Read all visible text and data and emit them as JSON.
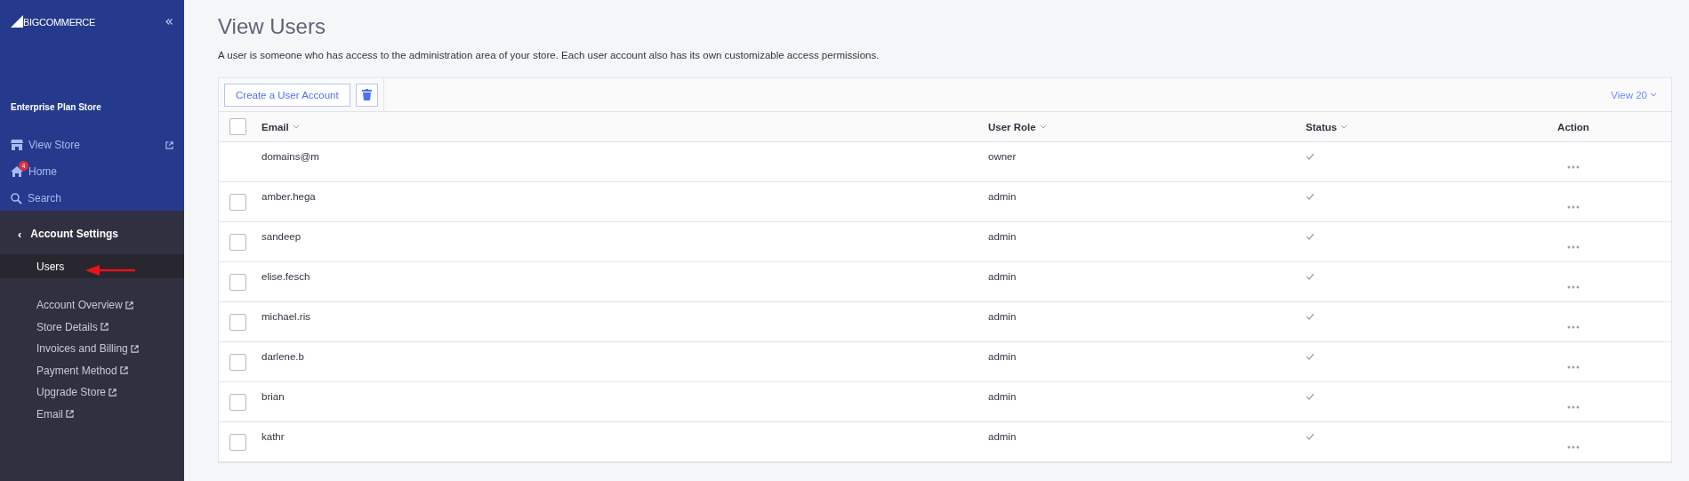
{
  "sidebar": {
    "brand": "BIGCOMMERCE",
    "collapse_icon": "«",
    "plan": "Enterprise Plan Store",
    "nav": [
      {
        "kind": "store",
        "label": "View Store",
        "external": true
      },
      {
        "kind": "home",
        "label": "Home",
        "badge": "4",
        "external": false
      },
      {
        "kind": "search",
        "label": "Search",
        "external": false
      }
    ],
    "section": {
      "back_icon": "‹",
      "title": "Account Settings",
      "items": [
        {
          "label": "Users",
          "selected": true,
          "external": false
        }
      ],
      "links": [
        {
          "label": "Account Overview",
          "external": true
        },
        {
          "label": "Store Details",
          "external": true
        },
        {
          "label": "Invoices and Billing",
          "external": true
        },
        {
          "label": "Payment Method",
          "external": true
        },
        {
          "label": "Upgrade Store",
          "external": true
        },
        {
          "label": "Email",
          "external": true
        }
      ]
    }
  },
  "page": {
    "title": "View Users",
    "description": "A user is someone who has access to the administration area of your store. Each user account also has its own customizable access permissions."
  },
  "toolbar": {
    "create_button": "Create a User Account",
    "view_select": "View 20"
  },
  "table": {
    "all_checked": false,
    "columns": [
      "Email",
      "User Role",
      "Status",
      "Action"
    ],
    "rows": [
      {
        "email": "domains@m",
        "role": "owner",
        "active": true,
        "selectable": false
      },
      {
        "email": "amber.hega",
        "role": "admin",
        "active": true,
        "selectable": true,
        "checked": false
      },
      {
        "email": "sandeep",
        "role": "admin",
        "active": true,
        "selectable": true,
        "checked": false
      },
      {
        "email": "elise.fesch",
        "role": "admin",
        "active": true,
        "selectable": true,
        "checked": false
      },
      {
        "email": "michael.ris",
        "role": "admin",
        "active": true,
        "selectable": true,
        "checked": false
      },
      {
        "email": "darlene.b",
        "role": "admin",
        "active": true,
        "selectable": true,
        "checked": false
      },
      {
        "email": "brian",
        "role": "admin",
        "active": true,
        "selectable": true,
        "checked": false
      },
      {
        "email": "kathr",
        "role": "admin",
        "active": true,
        "selectable": true,
        "checked": false
      }
    ]
  }
}
